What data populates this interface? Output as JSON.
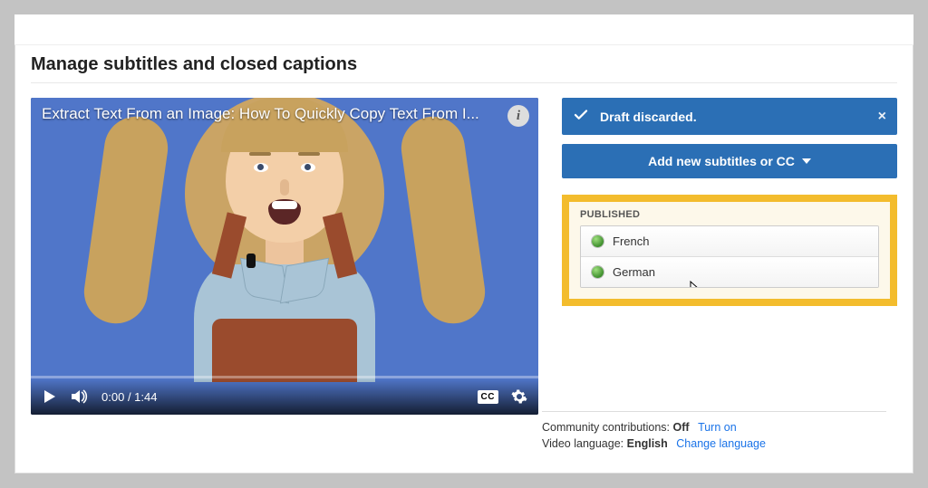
{
  "page_title": "Manage subtitles and closed captions",
  "video": {
    "title_overlay": "Extract Text From an Image: How To Quickly Copy Text From I...",
    "current_time": "0:00",
    "duration": "1:44",
    "cc_badge": "CC"
  },
  "banner": {
    "message": "Draft discarded.",
    "close": "×"
  },
  "add_button_label": "Add new subtitles or CC",
  "published": {
    "heading": "PUBLISHED",
    "items": [
      {
        "language": "French"
      },
      {
        "language": "German"
      }
    ]
  },
  "footer": {
    "contrib_label": "Community contributions:",
    "contrib_value": "Off",
    "contrib_action": "Turn on",
    "lang_label": "Video language:",
    "lang_value": "English",
    "lang_action": "Change language"
  },
  "info_glyph": "i"
}
